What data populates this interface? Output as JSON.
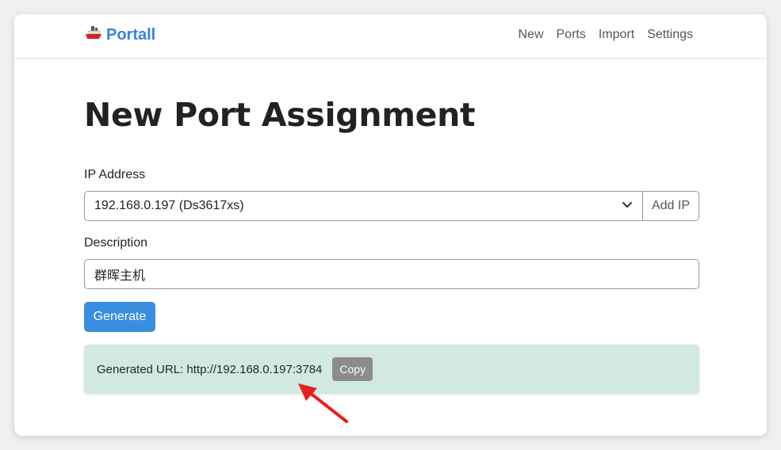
{
  "navbar": {
    "brand": {
      "icon": "ship-icon",
      "label": "Portall"
    },
    "links": [
      {
        "label": "New"
      },
      {
        "label": "Ports"
      },
      {
        "label": "Import"
      },
      {
        "label": "Settings"
      }
    ]
  },
  "page": {
    "title": "New Port Assignment"
  },
  "form": {
    "ip_label": "IP Address",
    "ip_selected": "192.168.0.197 (Ds3617xs)",
    "add_ip_label": "Add IP",
    "description_label": "Description",
    "description_value": "群晖主机",
    "generate_label": "Generate"
  },
  "result": {
    "text": "Generated URL: http://192.168.0.197:3784",
    "copy_label": "Copy"
  },
  "colors": {
    "brand": "#3583e0",
    "primary_button": "#3a8ee0",
    "result_bg": "#d2e9e0",
    "copy_button": "#8c8c8c",
    "annotation_arrow": "#e8201e"
  }
}
